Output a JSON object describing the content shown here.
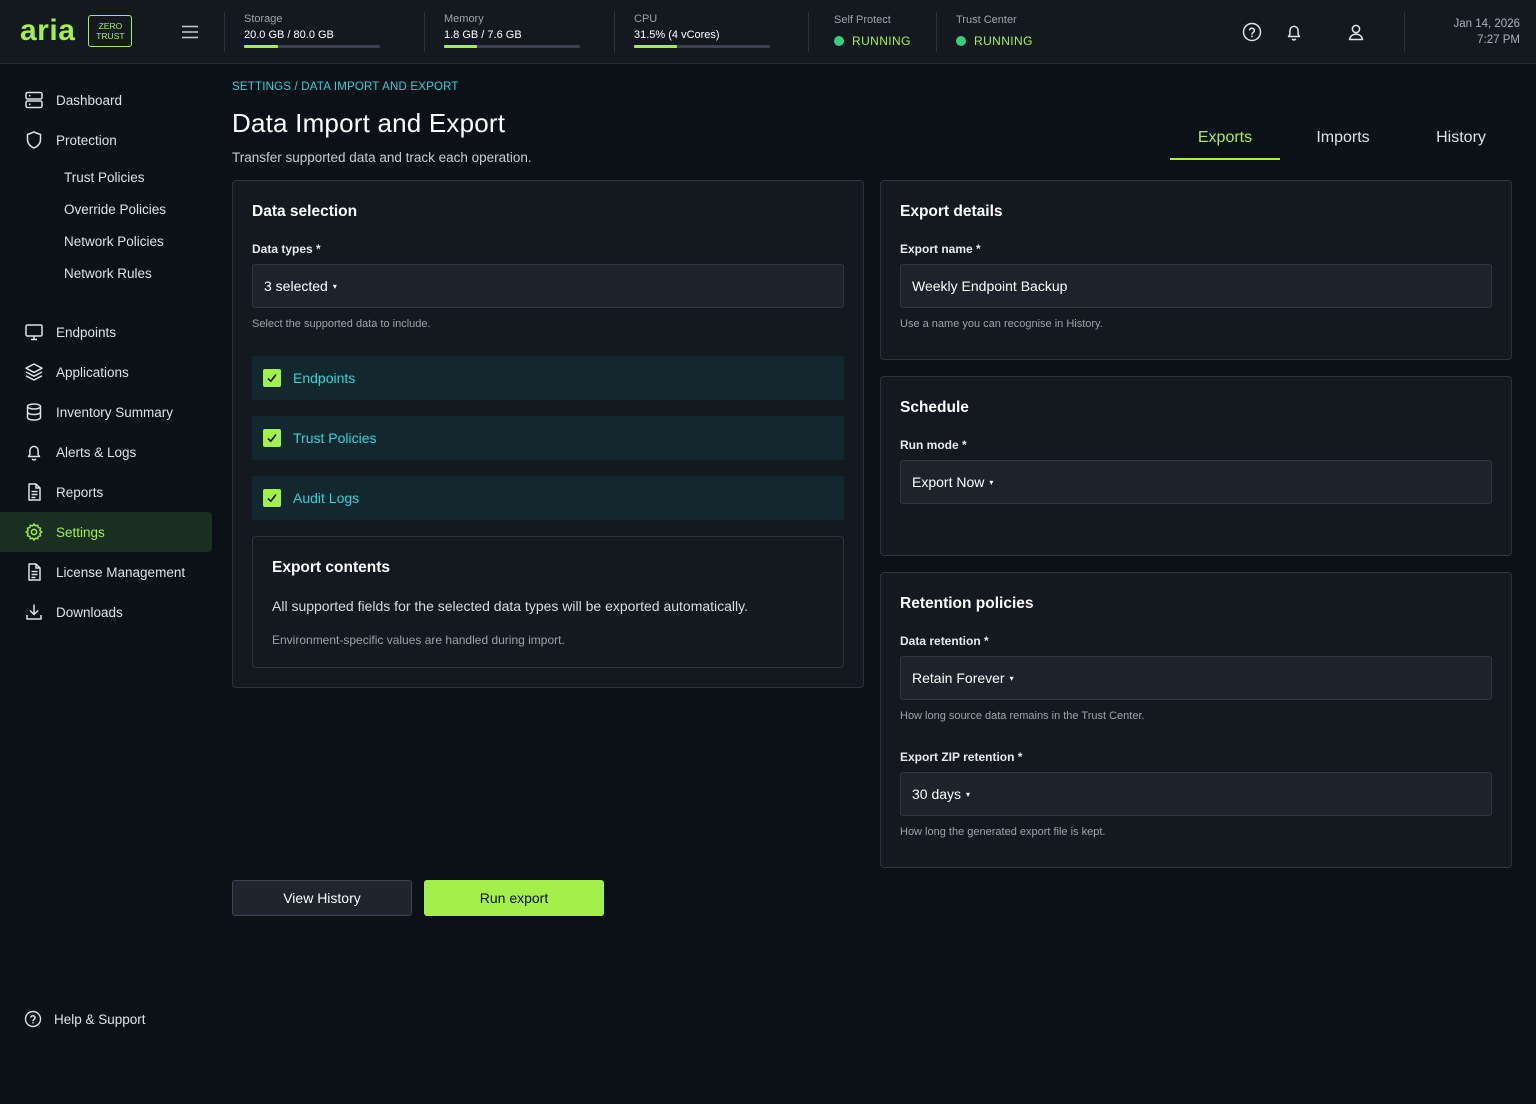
{
  "brand": {
    "name": "aria",
    "badge_line1": "ZERO",
    "badge_line2": "TRUST",
    "accent_color": "#a3f04a"
  },
  "topbar": {
    "metrics": [
      {
        "label": "Storage",
        "value": "20.0 GB / 80.0 GB",
        "fraction": 0.25
      },
      {
        "label": "Memory",
        "value": "1.8 GB / 7.6 GB",
        "fraction": 0.24
      },
      {
        "label": "CPU",
        "value": "31.5% (4 vCores)",
        "fraction": 0.315
      }
    ],
    "statuses": [
      {
        "label": "Self Protect",
        "value": "RUNNING"
      },
      {
        "label": "Trust Center",
        "value": "RUNNING"
      }
    ],
    "icons": [
      "menu-icon",
      "help-circle-icon",
      "bell-icon",
      "user-icon"
    ],
    "date": "Jan 14, 2026",
    "time": "7:27 PM"
  },
  "sidebar": {
    "items": [
      {
        "label": "Dashboard",
        "icon": "server-icon"
      },
      {
        "label": "Protection",
        "icon": "shield-icon"
      },
      {
        "label": "Endpoints",
        "icon": "monitor-icon"
      },
      {
        "label": "Applications",
        "icon": "layers-icon"
      },
      {
        "label": "Inventory Summary",
        "icon": "database-icon"
      },
      {
        "label": "Alerts & Logs",
        "icon": "bell-icon"
      },
      {
        "label": "Reports",
        "icon": "file-text-icon"
      },
      {
        "label": "Settings",
        "icon": "gear-icon",
        "active": true
      },
      {
        "label": "License Management",
        "icon": "file-text-icon"
      },
      {
        "label": "Downloads",
        "icon": "download-icon"
      }
    ],
    "protection_sub": [
      "Trust Policies",
      "Override Policies",
      "Network Policies",
      "Network Rules"
    ],
    "help": "Help & Support"
  },
  "page": {
    "breadcrumb_root": "SETTINGS",
    "breadcrumb_sep": " / ",
    "breadcrumb_current": "DATA IMPORT AND EXPORT",
    "title": "Data Import and Export",
    "subtitle": "Transfer supported data and track each operation.",
    "tabs": [
      {
        "label": "Exports",
        "active": true
      },
      {
        "label": "Imports"
      },
      {
        "label": "History"
      }
    ]
  },
  "data_selection": {
    "title": "Data selection",
    "data_types_label": "Data types *",
    "data_types_value": "3 selected",
    "data_types_hint": "Select the supported data to include.",
    "options": [
      {
        "label": "Endpoints",
        "checked": true
      },
      {
        "label": "Trust Policies",
        "checked": true
      },
      {
        "label": "Audit Logs",
        "checked": true
      }
    ],
    "export_contents": {
      "title": "Export contents",
      "text": "All supported fields for the selected data types will be exported automatically.",
      "hint": "Environment-specific values are handled during import."
    }
  },
  "export_details": {
    "title": "Export details",
    "name_label": "Export name *",
    "name_value": "Weekly Endpoint Backup",
    "name_hint": "Use a name you can recognise in History."
  },
  "schedule": {
    "title": "Schedule",
    "run_mode_label": "Run mode *",
    "run_mode_value": "Export Now"
  },
  "retention": {
    "title": "Retention policies",
    "data_label": "Data retention *",
    "data_value": "Retain Forever",
    "data_hint": "How long source data remains in the Trust Center.",
    "zip_label": "Export ZIP retention *",
    "zip_value": "30 days",
    "zip_hint": "How long the generated export file is kept."
  },
  "actions": {
    "view_history": "View History",
    "run_export": "Run export"
  }
}
